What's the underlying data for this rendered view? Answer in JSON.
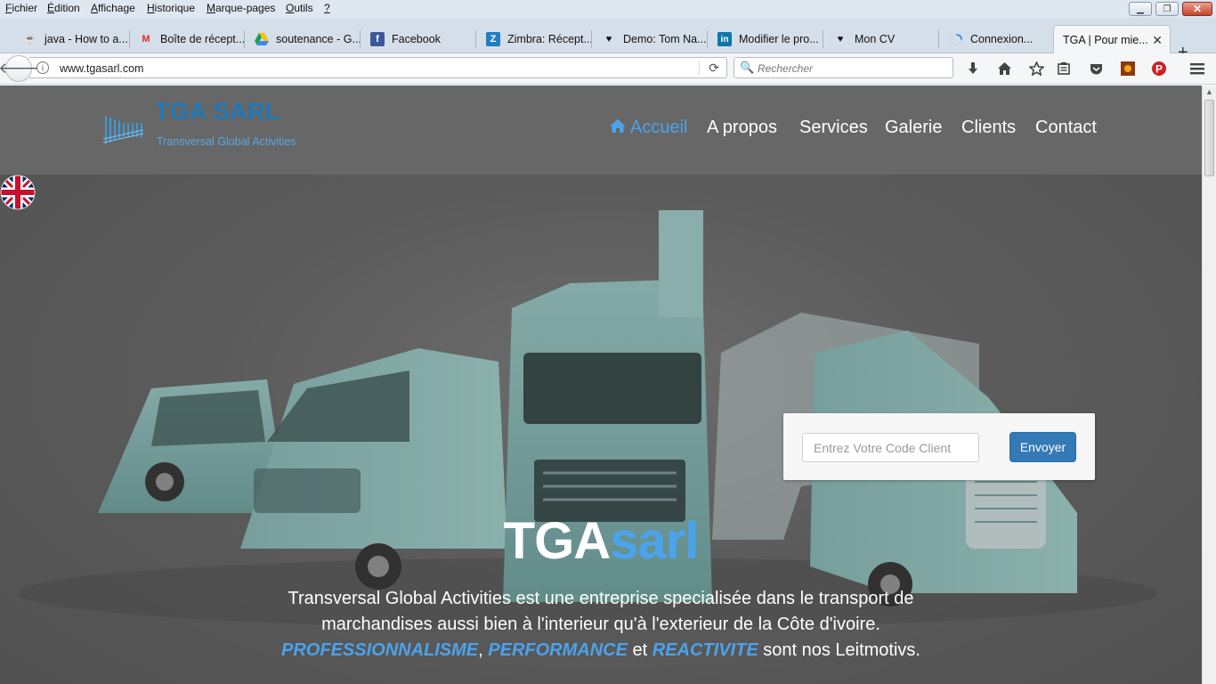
{
  "menubar": {
    "items": [
      {
        "u": "F",
        "rest": "ichier"
      },
      {
        "u": "É",
        "rest": "dition"
      },
      {
        "u": "A",
        "rest": "ffichage"
      },
      {
        "u": "H",
        "rest": "istorique"
      },
      {
        "u": "M",
        "rest": "arque-pages"
      },
      {
        "u": "O",
        "rest": "utils"
      },
      {
        "u": "?",
        "rest": ""
      }
    ]
  },
  "tabs": [
    {
      "label": "java - How to a...",
      "icon": "java-icon"
    },
    {
      "label": "Boîte de récept...",
      "icon": "gmail-icon"
    },
    {
      "label": "soutenance - G...",
      "icon": "google-drive-icon"
    },
    {
      "label": "Facebook",
      "icon": "facebook-icon"
    },
    {
      "label": "Zimbra: Récept...",
      "icon": "zimbra-icon"
    },
    {
      "label": "Demo: Tom Na...",
      "icon": "heart-icon"
    },
    {
      "label": "Modifier le pro...",
      "icon": "linkedin-icon"
    },
    {
      "label": "Mon CV",
      "icon": "heart-icon"
    },
    {
      "label": "Connexion...",
      "icon": "loading-spinner-icon"
    },
    {
      "label": "TGA | Pour mie...",
      "icon": "",
      "active": true
    }
  ],
  "navbar": {
    "url": "www.tgasarl.com",
    "search_placeholder": "Rechercher"
  },
  "site": {
    "logo_title": "TGA SARL",
    "logo_subtitle": "Transversal Global Activities",
    "nav": [
      "Accueil",
      "A propos",
      "Services",
      "Galerie",
      "Clients",
      "Contact"
    ],
    "active_nav": "Accueil",
    "code_placeholder": "Entrez Votre Code Client",
    "submit_label": "Envoyer",
    "hero_title_a": "TGA",
    "hero_title_b": "sarl",
    "hero_line1": "Transversal Global Activities est une entreprise specialisée dans le transport de marchandises aussi bien à l'interieur qu'à l'exterieur de la Côte d'ivoire.",
    "kw1": "PROFESSIONNALISME",
    "kw2": "PERFORMANCE",
    "kw3": "REACTIVITE",
    "comma": ",",
    "et": "et",
    "tail": "sont nos Leitmotivs."
  },
  "colors": {
    "brand_blue": "#1f78b8",
    "accent_blue": "#4ba3ec",
    "button_blue": "#337ab7",
    "header_gray": "#676767"
  }
}
